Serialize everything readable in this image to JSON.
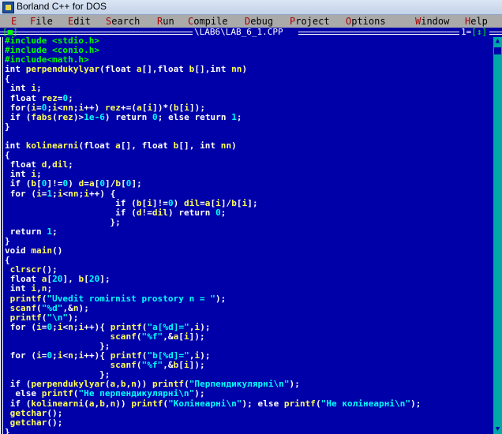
{
  "window": {
    "title": "Borland C++ for DOS"
  },
  "menu": [
    {
      "key": "E",
      "rest": ""
    },
    {
      "key": "F",
      "rest": "ile"
    },
    {
      "key": "E",
      "rest": "dit"
    },
    {
      "key": "S",
      "rest": "earch"
    },
    {
      "key": "R",
      "rest": "un"
    },
    {
      "key": "C",
      "rest": "ompile"
    },
    {
      "key": "D",
      "rest": "ebug"
    },
    {
      "key": "P",
      "rest": "roject"
    },
    {
      "key": "O",
      "rest": "ptions"
    },
    {
      "key": "W",
      "rest": "indow"
    },
    {
      "key": "H",
      "rest": "elp"
    }
  ],
  "editor": {
    "close_box": "[■]",
    "file_title": "\\LAB6\\LAB_6_1.CPP",
    "window_number": "1",
    "resize_arrows": "[↕]",
    "scroll_up": "▲",
    "scroll_down": "▼"
  },
  "code_lines": [
    "#include <stdio.h>",
    "#include <conio.h>",
    "#include<math.h>",
    "int perpendukylyar(float a[],float b[],int nn)",
    "{",
    " int i;",
    " float rez=0;",
    " for(i=0;i<nn;i++) rez+=(a[i])*(b[i]);",
    " if (fabs(rez)>1e-6) return 0; else return 1;",
    "}",
    "",
    "int kolinearni(float a[], float b[], int nn)",
    "{",
    " float d,dil;",
    " int i;",
    " if (b[0]!=0) d=a[0]/b[0];",
    " for (i=1;i<nn;i++) {",
    "                     if (b[i]!=0) dil=a[i]/b[i];",
    "                     if (d!=dil) return 0;",
    "                    };",
    " return 1;",
    "}",
    "void main()",
    "{",
    " clrscr();",
    " float a[20], b[20];",
    " int i,n;",
    " printf(\"Uvedit romirnist prostory n = \");",
    " scanf(\"%d\",&n);",
    " printf(\"\\n\");",
    " for (i=0;i<n;i++){ printf(\"a[%d]=\",i);",
    "                    scanf(\"%f\",&a[i]);",
    "                  };",
    " for (i=0;i<n;i++){ printf(\"b[%d]=\",i);",
    "                    scanf(\"%f\",&b[i]);",
    "                  };",
    " if (perpendukylyar(a,b,n)) printf(\"Перпендикулярні\\n\");",
    "  else printf(\"Не перпендикулярні\\n\");",
    " if (kolinearni(a,b,n)) printf(\"Колінеарні\\n\"); else printf(\"Не колінеарні\\n\");",
    " getchar();",
    " getchar();",
    "}"
  ],
  "colors": {
    "editor_bg": "#0000A8",
    "identifier": "#FFFF55",
    "keyword": "#FFFFFF",
    "preprocessor": "#00FF00",
    "literal": "#00FFFF",
    "menu_bg": "#AAAAAA",
    "menu_hotkey": "#A80000"
  }
}
